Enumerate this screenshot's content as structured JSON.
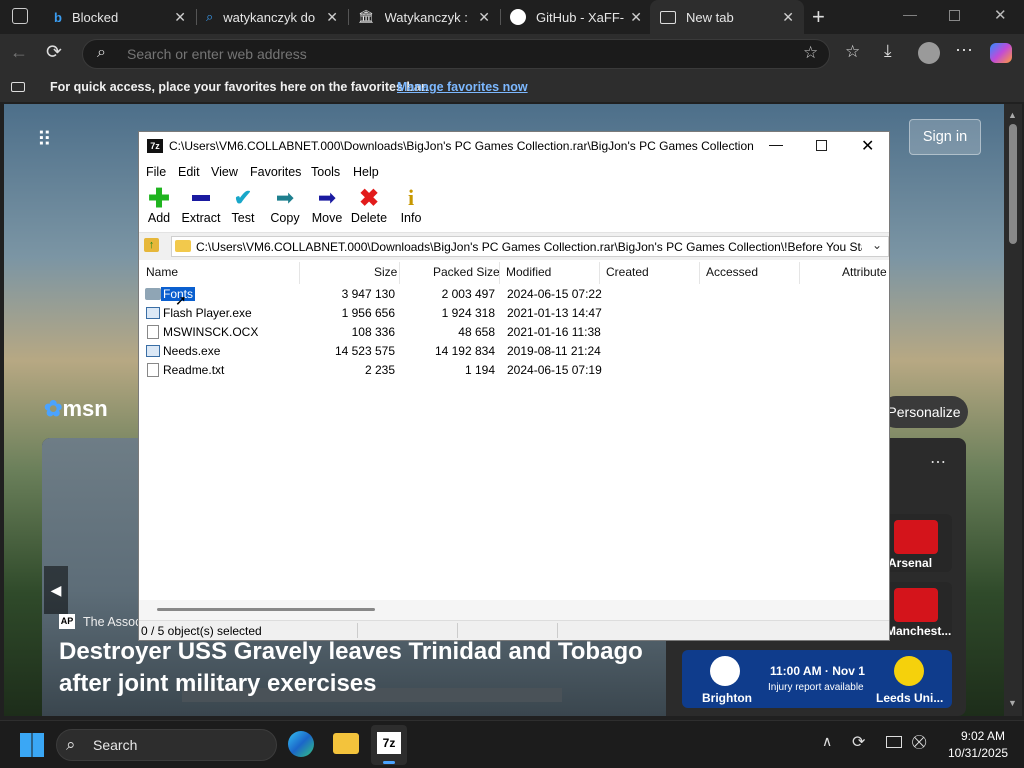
{
  "browser": {
    "tabs": [
      {
        "label": "Blocked",
        "icon": "bing-icon"
      },
      {
        "label": "watykanczyk do",
        "icon": "search-icon"
      },
      {
        "label": "Watykanczyk : Fr",
        "icon": "museum-icon"
      },
      {
        "label": "GitHub - XaFF-Xa",
        "icon": "github-icon"
      },
      {
        "label": "New tab",
        "icon": "newtab-icon"
      }
    ],
    "address_placeholder": "Search or enter web address",
    "favorites_message": "For quick access, place your favorites here on the favorites bar.",
    "favorites_link": "Manage favorites now"
  },
  "msn": {
    "sign_in": "Sign in",
    "logo": "msn",
    "personalize": "Personalize",
    "source": "The Associ",
    "headline_line1": "Destroyer USS Gravely leaves Trinidad and Tobago",
    "headline_line2": "after joint military exercises",
    "cards": [
      {
        "right_label": "Arsenal",
        "color": "#d4141b"
      },
      {
        "right_label": "Manchest...",
        "color": "#d4141b"
      },
      {
        "left_label": "Brighton",
        "time": "11:00 AM · Nov 1",
        "note": "Injury report available",
        "right_label": "Leeds Uni..."
      }
    ]
  },
  "sevenzip": {
    "title": "C:\\Users\\VM6.COLLABNET.000\\Downloads\\BigJon's PC Games Collection.rar\\BigJon's PC Games Collection\\!...",
    "menu": [
      "File",
      "Edit",
      "View",
      "Favorites",
      "Tools",
      "Help"
    ],
    "toolbar": [
      "Add",
      "Extract",
      "Test",
      "Copy",
      "Move",
      "Delete",
      "Info"
    ],
    "path": "C:\\Users\\VM6.COLLABNET.000\\Downloads\\BigJon's PC Games Collection.rar\\BigJon's PC Games Collection\\!Before You Start\\",
    "columns": [
      "Name",
      "Size",
      "Packed Size",
      "Modified",
      "Created",
      "Accessed",
      "Attribute"
    ],
    "rows": [
      {
        "name": "Fonts",
        "size": "3 947 130",
        "packed": "2 003 497",
        "modified": "2024-06-15 07:22",
        "type": "folder"
      },
      {
        "name": "Flash Player.exe",
        "size": "1 956 656",
        "packed": "1 924 318",
        "modified": "2021-01-13 14:47",
        "type": "exe"
      },
      {
        "name": "MSWINSCK.OCX",
        "size": "108 336",
        "packed": "48 658",
        "modified": "2021-01-16 11:38",
        "type": "file"
      },
      {
        "name": "Needs.exe",
        "size": "14 523 575",
        "packed": "14 192 834",
        "modified": "2019-08-11 21:24",
        "type": "exe"
      },
      {
        "name": "Readme.txt",
        "size": "2 235",
        "packed": "1 194",
        "modified": "2024-06-15 07:19",
        "type": "txt"
      }
    ],
    "status": "0 / 5 object(s) selected"
  },
  "taskbar": {
    "search": "Search",
    "time": "9:02 AM",
    "date": "10/31/2025"
  }
}
